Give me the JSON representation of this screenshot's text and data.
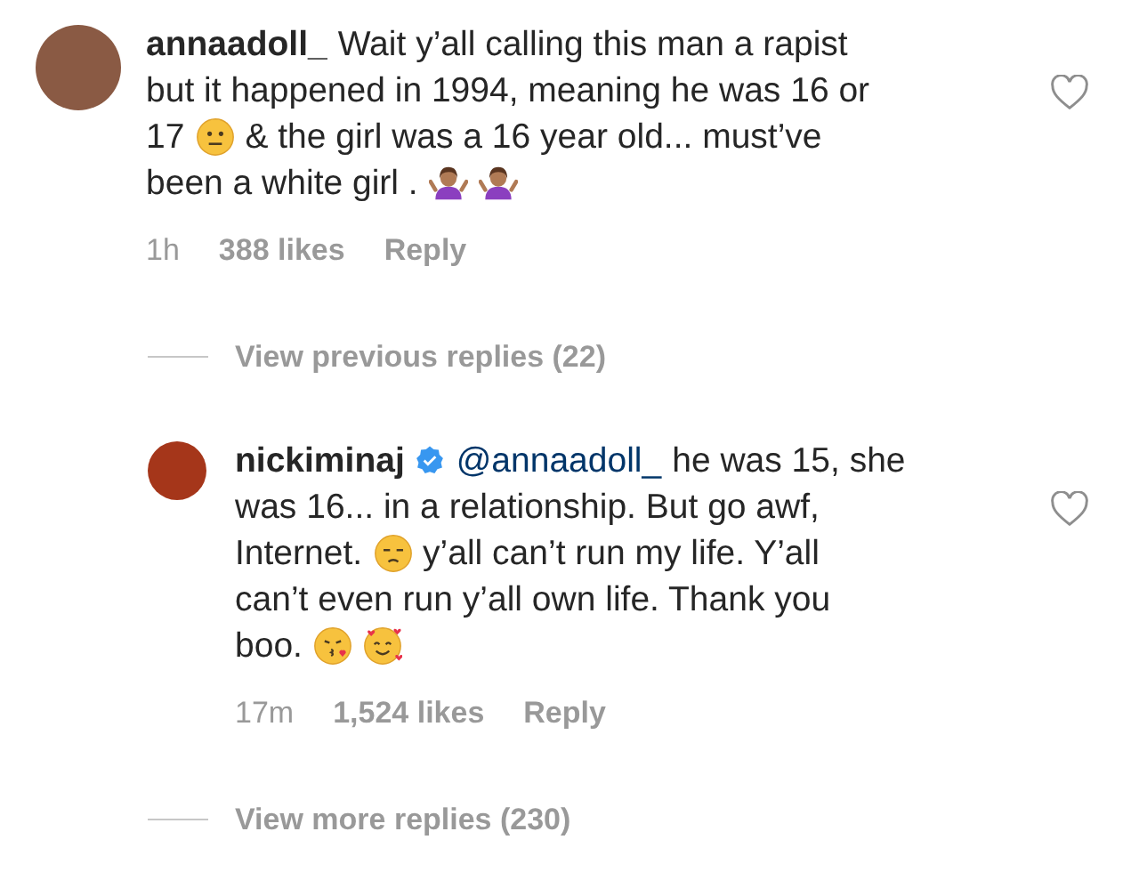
{
  "comments": [
    {
      "username": "annaadoll_",
      "verified": false,
      "liked": false,
      "lines": [
        [
          {
            "kind": "text",
            "text": "Wait y’all calling this man a rapist"
          }
        ],
        [
          {
            "kind": "text",
            "text": "but it happened in 1994, meaning he was 16 or"
          }
        ],
        [
          {
            "kind": "text",
            "text": "17"
          },
          {
            "kind": "neutral-face"
          },
          {
            "kind": "text",
            "text": "& the girl was a 16 year old... must’ve"
          }
        ],
        [
          {
            "kind": "text",
            "text": "been a white girl ."
          },
          {
            "kind": "shrug"
          },
          {
            "kind": "shrug"
          }
        ]
      ],
      "time": "1h",
      "likes": "388 likes",
      "reply": "Reply",
      "thread_link": "View previous replies (22)",
      "replies": [
        {
          "username": "nickiminaj",
          "verified": true,
          "liked": false,
          "lines": [
            [
              {
                "kind": "mention",
                "text": "@annaadoll_"
              },
              {
                "kind": "text",
                "text": "he was 15, she"
              }
            ],
            [
              {
                "kind": "text",
                "text": "was 16... in a relationship. But go awf,"
              }
            ],
            [
              {
                "kind": "text",
                "text": "Internet."
              },
              {
                "kind": "unamused-face"
              },
              {
                "kind": "text",
                "text": "y’all can’t run my life. Y’all"
              }
            ],
            [
              {
                "kind": "text",
                "text": "can’t even run y’all own life. Thank you"
              }
            ],
            [
              {
                "kind": "text",
                "text": "boo."
              },
              {
                "kind": "kiss-face"
              },
              {
                "kind": "hearts-face"
              }
            ]
          ],
          "time": "17m",
          "likes": "1,524 likes",
          "reply": "Reply"
        }
      ],
      "more_link": "View more replies (230)"
    }
  ]
}
